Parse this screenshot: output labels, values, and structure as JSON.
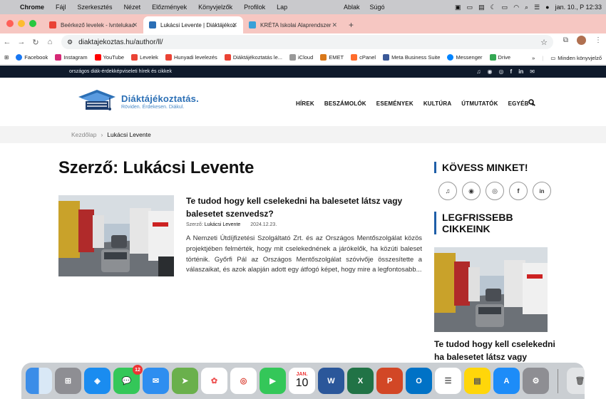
{
  "menubar": {
    "app": "Chrome",
    "items": [
      "Fájl",
      "Szerkesztés",
      "Nézet",
      "Előzmények",
      "Könyvjelzők",
      "Profilok",
      "Lap"
    ],
    "items_right": [
      "Ablak",
      "Súgó"
    ],
    "clock": "jan. 10., P  12:33"
  },
  "tabs": [
    {
      "label": "Beérkező levelek - lvntelukac"
    },
    {
      "label": "Lukácsi Levente | Diáktájékoz"
    },
    {
      "label": "KRÉTA Iskolai Alaprendszer"
    }
  ],
  "url": "diaktajekoztas.hu/author/ll/",
  "bookmarks": [
    "Facebook",
    "Instagram",
    "YouTube",
    "Levelek",
    "Hunyadi levelezés",
    "Diáktájékoztatás le...",
    "iCloud",
    "EMET",
    "cPanel",
    "Meta Business Suite",
    "Messenger",
    "Drive"
  ],
  "bookmarks_more": "»",
  "bookmarks_folder": "Minden könyvjelző",
  "site": {
    "tagline": "országos diák-érdekképviseleti hírek és cikkek",
    "logo_title": "Diáktájékoztatás.",
    "logo_sub": "Röviden. Érdekesen. Diákul.",
    "nav": [
      "HÍREK",
      "BESZÁMOLÓK",
      "ESEMÉNYEK",
      "KULTÚRA",
      "ÚTMUTATÓK",
      "EGYÉB ⌄"
    ],
    "breadcrumb_home": "Kezdőlap",
    "breadcrumb_sep": "›",
    "breadcrumb_current": "Lukácsi Levente",
    "page_title": "Szerző: Lukácsi Levente",
    "post": {
      "title": "Te tudod hogy kell cselekedni ha balesetet látsz vagy balesetet szenvedsz?",
      "author_label": "Szerző:",
      "author": "Lukácsi Levente",
      "date": "2024.12.23.",
      "excerpt": "A Nemzeti Útdíjfizetési Szolgáltató Zrt. és az Országos Mentőszolgálat közös projektjében felmérték, hogy mit cselekednének a járókelők, ha közúti baleset történik. Győrfi Pál az Országos Mentőszolgálat szóvivője összesítette a válaszaikat, és azok alapján adott egy átfogó képet, hogy mire a legfontosabb..."
    },
    "sidebar": {
      "follow_heading": "KÖVESS MINKET!",
      "latest_heading": "LEGFRISSEBB CIKKEINK",
      "latest_title": "Te tudod hogy kell cselekedni ha balesetet látsz vagy"
    }
  },
  "dock": {
    "messages_badge": "12",
    "calendar_month": "JAN.",
    "calendar_day": "10"
  },
  "colors": {
    "tabbar": "#f6c7c2",
    "site_topbar": "#0f1a2b",
    "accent": "#1f5fa8"
  }
}
